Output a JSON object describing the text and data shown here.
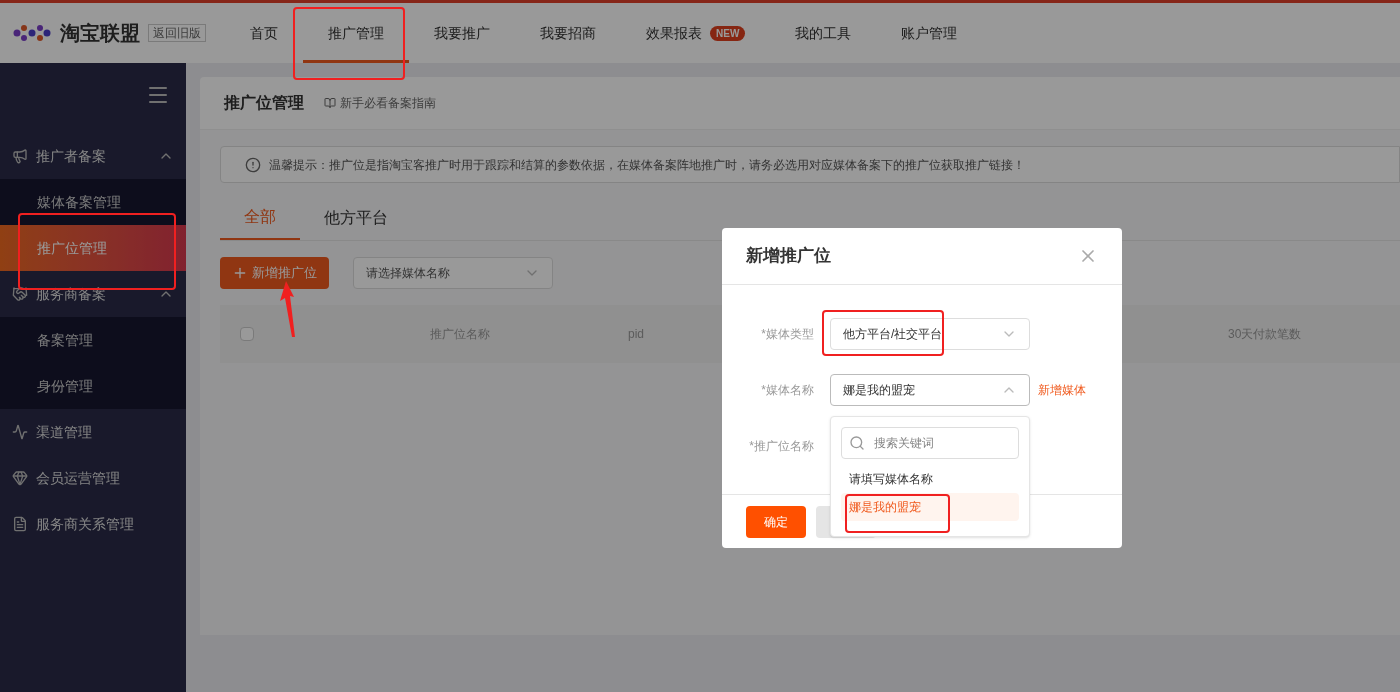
{
  "header": {
    "logo": "淘宝联盟",
    "old_version": "返回旧版",
    "nav": [
      {
        "label": "首页",
        "selected": false
      },
      {
        "label": "推广管理",
        "selected": true
      },
      {
        "label": "我要推广",
        "selected": false
      },
      {
        "label": "我要招商",
        "selected": false
      },
      {
        "label": "效果报表",
        "selected": false,
        "badge": "NEW"
      },
      {
        "label": "我的工具",
        "selected": false
      },
      {
        "label": "账户管理",
        "selected": false
      }
    ]
  },
  "sidebar": {
    "groups": [
      {
        "label": "推广者备案",
        "expanded": true,
        "children": [
          {
            "label": "媒体备案管理",
            "selected": false
          },
          {
            "label": "推广位管理",
            "selected": true
          }
        ]
      },
      {
        "label": "服务商备案",
        "expanded": true,
        "children": [
          {
            "label": "备案管理",
            "selected": false
          },
          {
            "label": "身份管理",
            "selected": false
          }
        ]
      },
      {
        "label": "渠道管理"
      },
      {
        "label": "会员运营管理"
      },
      {
        "label": "服务商关系管理"
      }
    ]
  },
  "page": {
    "title": "推广位管理",
    "guide_link": "新手必看备案指南",
    "notice": "温馨提示：推广位是指淘宝客推广时用于跟踪和结算的参数依据，在媒体备案阵地推广时，请务必选用对应媒体备案下的推广位获取推广链接！",
    "tabs": [
      {
        "label": "全部",
        "selected": true
      },
      {
        "label": "他方平台",
        "selected": false
      }
    ],
    "add_button": "新增推广位",
    "media_select": {
      "placeholder": "请选择媒体名称"
    },
    "table": {
      "checkbox": {
        "checked": false
      },
      "columns": [
        "推广位名称",
        "pid",
        "30天付款笔数"
      ]
    }
  },
  "dialog": {
    "title": "新增推广位",
    "fields": [
      {
        "label": "*媒体类型",
        "value": "他方平台/社交平台",
        "expanded": false
      },
      {
        "label": "*媒体名称",
        "value": "娜是我的盟宠",
        "expanded": true,
        "link": "新增媒体"
      },
      {
        "label": "*推广位名称"
      }
    ],
    "dropdown": {
      "search_placeholder": "搜索关键词",
      "options": [
        {
          "label": "请填写媒体名称",
          "selected": false
        },
        {
          "label": "娜是我的盟宠",
          "selected": true
        }
      ]
    },
    "confirm_button": "确定"
  }
}
